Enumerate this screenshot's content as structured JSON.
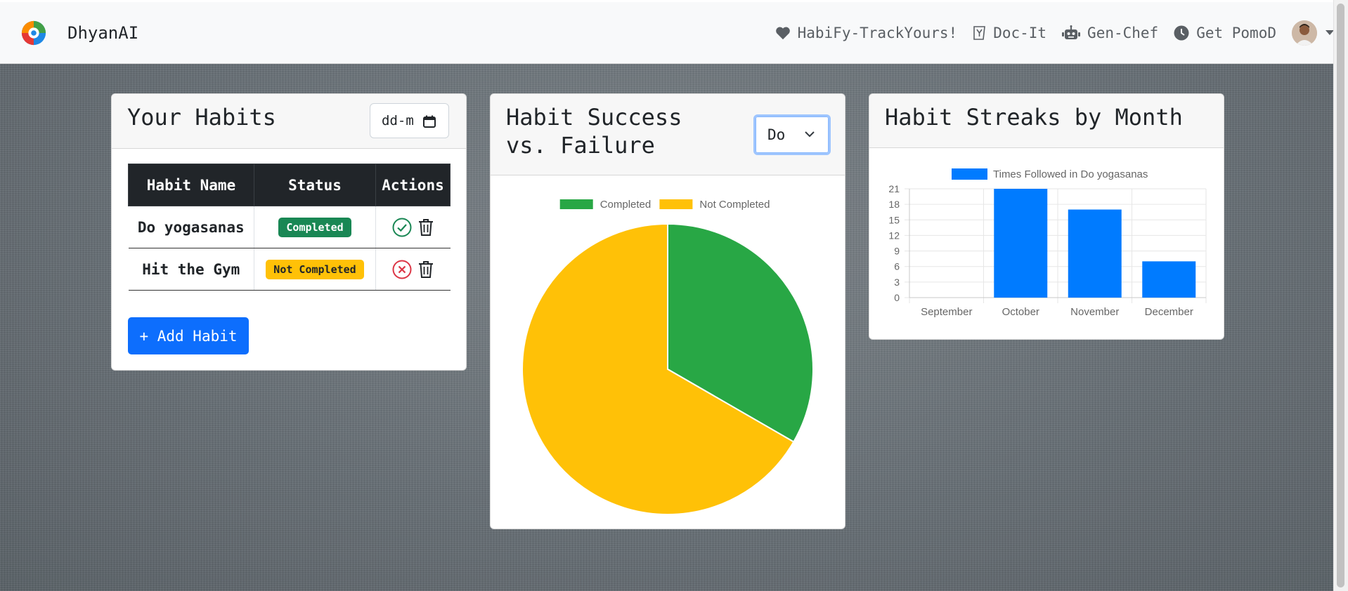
{
  "app": {
    "name": "DhyanAI"
  },
  "nav": {
    "links": [
      {
        "label": "HabiFy-TrackYours!",
        "icon": "heart-icon"
      },
      {
        "label": "Doc-It",
        "icon": "y-box-icon"
      },
      {
        "label": "Gen-Chef",
        "icon": "robot-icon"
      },
      {
        "label": "Get PomoD",
        "icon": "clock-icon"
      }
    ]
  },
  "habits_card": {
    "title": "Your Habits",
    "date_placeholder": "dd-m",
    "columns": [
      "Habit Name",
      "Status",
      "Actions"
    ],
    "rows": [
      {
        "name": "Do yogasanas",
        "status": "Completed",
        "status_type": "success"
      },
      {
        "name": "Hit the Gym",
        "status": "Not Completed",
        "status_type": "warning"
      }
    ],
    "add_label": "+ Add Habit"
  },
  "pie_card": {
    "title": "Habit Success vs. Failure",
    "select_value": "Do"
  },
  "bar_card": {
    "title": "Habit Streaks by Month"
  },
  "colors": {
    "primary": "#0d6efd",
    "success": "#198754",
    "warning": "#ffc107",
    "danger": "#dc3545",
    "pie_completed": "#28a745",
    "pie_not_completed": "#ffc107",
    "bar": "#007bff"
  },
  "chart_data": [
    {
      "type": "pie",
      "categories": [
        "Completed",
        "Not Completed"
      ],
      "values": [
        1,
        2
      ],
      "legend": "top"
    },
    {
      "type": "bar",
      "categories": [
        "September",
        "October",
        "November",
        "December"
      ],
      "series": [
        {
          "name": "Times Followed in Do yogasanas",
          "values": [
            0,
            21,
            17,
            7
          ]
        }
      ],
      "yticks": [
        0,
        3,
        6,
        9,
        12,
        15,
        18,
        21
      ],
      "ylim": [
        0,
        21
      ],
      "grid": true,
      "legend": "top"
    }
  ]
}
